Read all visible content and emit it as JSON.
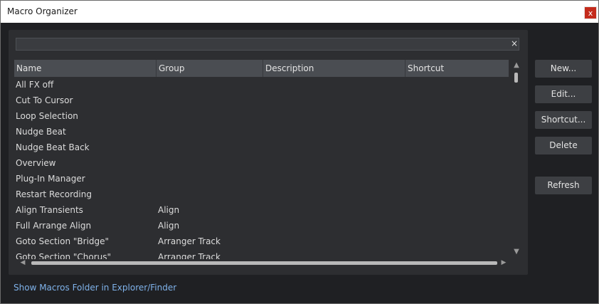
{
  "window": {
    "title": "Macro Organizer",
    "close_label": "x"
  },
  "search": {
    "value": "",
    "clear_label": "×"
  },
  "table": {
    "columns": [
      "Name",
      "Group",
      "Description",
      "Shortcut"
    ],
    "rows": [
      {
        "name": "All FX off",
        "group": "",
        "description": "",
        "shortcut": ""
      },
      {
        "name": "Cut To Cursor",
        "group": "",
        "description": "",
        "shortcut": ""
      },
      {
        "name": "Loop Selection",
        "group": "",
        "description": "",
        "shortcut": ""
      },
      {
        "name": "Nudge Beat",
        "group": "",
        "description": "",
        "shortcut": ""
      },
      {
        "name": "Nudge Beat Back",
        "group": "",
        "description": "",
        "shortcut": ""
      },
      {
        "name": "Overview",
        "group": "",
        "description": "",
        "shortcut": ""
      },
      {
        "name": "Plug-In Manager",
        "group": "",
        "description": "",
        "shortcut": ""
      },
      {
        "name": "Restart Recording",
        "group": "",
        "description": "",
        "shortcut": ""
      },
      {
        "name": "Align Transients",
        "group": "Align",
        "description": "",
        "shortcut": ""
      },
      {
        "name": "Full Arrange Align",
        "group": "Align",
        "description": "",
        "shortcut": ""
      },
      {
        "name": "Goto Section \"Bridge\"",
        "group": "Arranger Track",
        "description": "",
        "shortcut": ""
      },
      {
        "name": "Goto Section \"Chorus\"",
        "group": "Arranger Track",
        "description": "",
        "shortcut": ""
      }
    ]
  },
  "buttons": {
    "new": "New...",
    "edit": "Edit...",
    "shortcut": "Shortcut...",
    "delete": "Delete",
    "refresh": "Refresh"
  },
  "footer": {
    "link": "Show Macros Folder in Explorer/Finder"
  },
  "icons": {
    "close": "close-icon",
    "clear": "clear-icon",
    "scroll_up": "arrow-up-icon",
    "scroll_down": "arrow-down-icon",
    "scroll_left": "arrow-left-icon",
    "scroll_right": "arrow-right-icon"
  },
  "colors": {
    "close_button": "#c42b1c",
    "link": "#7fb2ea",
    "header": "#4a4d52",
    "panel": "#2d2e31"
  }
}
